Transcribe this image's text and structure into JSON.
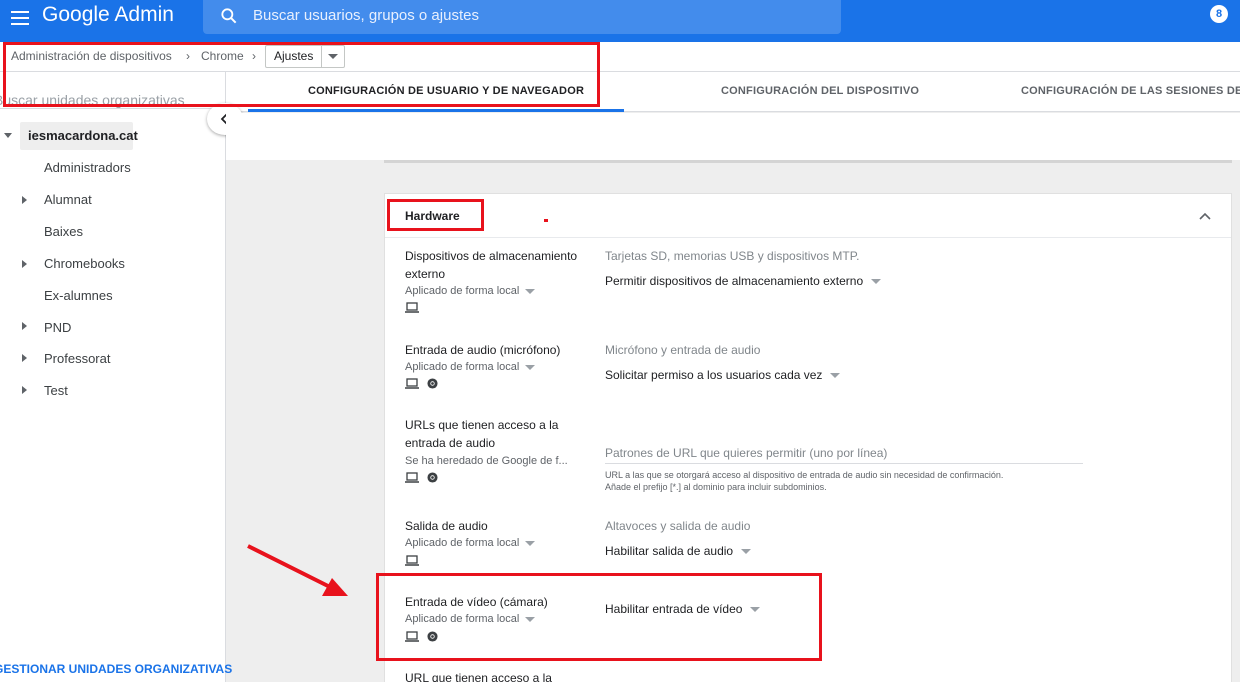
{
  "header": {
    "app_name": "Google Admin",
    "search_placeholder": "Buscar usuarios, grupos o ajustes",
    "avatar_label": "8"
  },
  "breadcrumb": {
    "items": [
      "Administración de dispositivos",
      "Chrome"
    ],
    "current": "Ajustes"
  },
  "sidebar": {
    "search_placeholder": "Buscar unidades organizativas",
    "root": "iesmacardona.cat",
    "items": [
      {
        "label": "Administradors",
        "expandable": false
      },
      {
        "label": "Alumnat",
        "expandable": true
      },
      {
        "label": "Baixes",
        "expandable": false
      },
      {
        "label": "Chromebooks",
        "expandable": true
      },
      {
        "label": "Ex-alumnes",
        "expandable": false
      },
      {
        "label": "PND",
        "expandable": true
      },
      {
        "label": "Professorat",
        "expandable": true
      },
      {
        "label": "Test",
        "expandable": true
      }
    ],
    "footer_link": "GESTIONAR UNIDADES ORGANIZATIVAS"
  },
  "tabs": [
    {
      "label": "CONFIGURACIÓN DE USUARIO Y DE NAVEGADOR",
      "active": true
    },
    {
      "label": "CONFIGURACIÓN DEL DISPOSITIVO",
      "active": false
    },
    {
      "label": "CONFIGURACIÓN DE LAS SESIONES DE INT",
      "active": false
    }
  ],
  "section": {
    "title": "Hardware",
    "settings": [
      {
        "name": "Dispositivos de almacenamiento externo",
        "applied": "Aplicado de forma local",
        "icons": [
          "laptop-icon"
        ],
        "description": "Tarjetas SD, memorias USB y dispositivos MTP.",
        "value": "Permitir dispositivos de almacenamiento externo"
      },
      {
        "name": "Entrada de audio (micrófono)",
        "applied": "Aplicado de forma local",
        "icons": [
          "laptop-icon",
          "chrome-icon"
        ],
        "description": "Micrófono y entrada de audio",
        "value": "Solicitar permiso a los usuarios cada vez"
      },
      {
        "name": "URLs que tienen acceso a la entrada de audio",
        "applied": "Se ha heredado de Google de f...",
        "icons": [
          "laptop-icon",
          "chrome-icon"
        ],
        "input_placeholder": "Patrones de URL que quieres permitir (uno por línea)",
        "help": "URL a las que se otorgará acceso al dispositivo de entrada de audio sin necesidad de confirmación. Añade el prefijo [*.] al dominio para incluir subdominios."
      },
      {
        "name": "Salida de audio",
        "applied": "Aplicado de forma local",
        "icons": [
          "laptop-icon"
        ],
        "description": "Altavoces y salida de audio",
        "value": "Habilitar salida de audio"
      },
      {
        "name": "Entrada de vídeo (cámara)",
        "applied": "Aplicado de forma local",
        "icons": [
          "laptop-icon",
          "chrome-icon"
        ],
        "value": "Habilitar entrada de vídeo"
      },
      {
        "name": "URL que tienen acceso a la"
      }
    ]
  },
  "colors": {
    "topbar": "#1a73e8",
    "annotation_red": "#e8121c"
  }
}
